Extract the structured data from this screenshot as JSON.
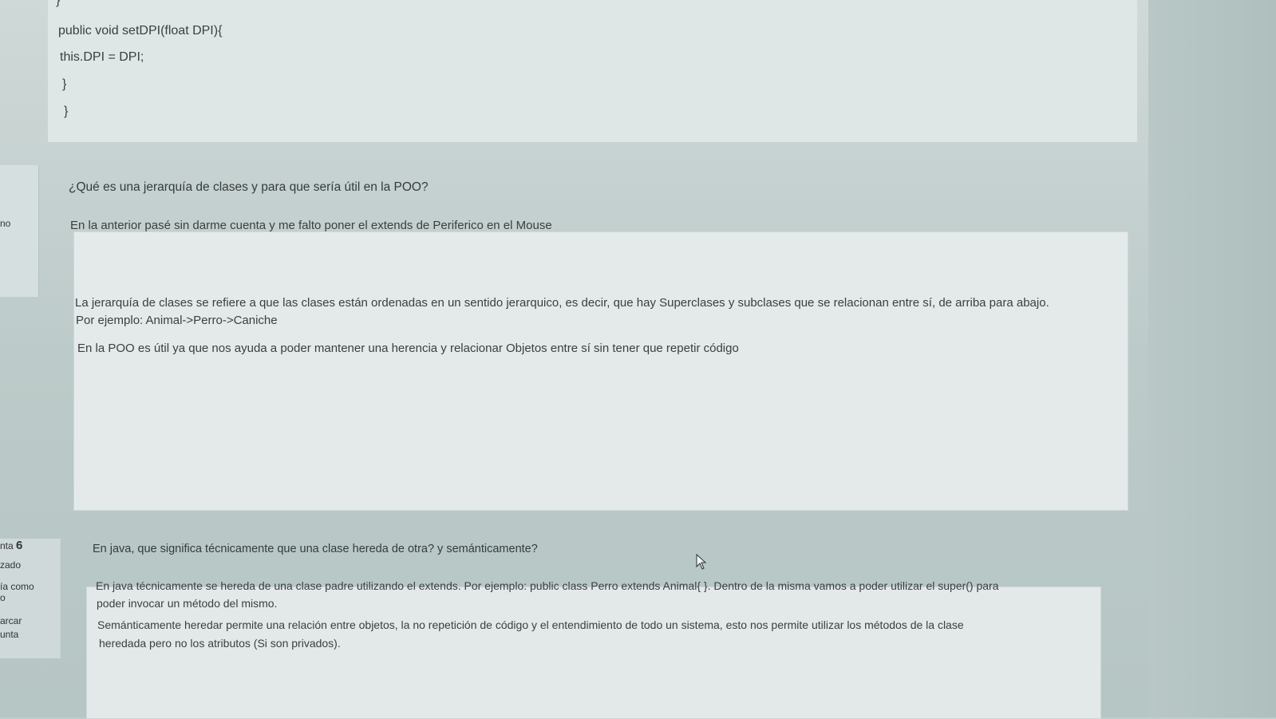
{
  "code": {
    "lines": [
      "}",
      "public void setDPI(float DPI){",
      "this.DPI = DPI;",
      "}",
      "}"
    ]
  },
  "question5": {
    "strip_label": "no",
    "question": "¿Qué es una jerarquía de clases y para que sería útil en la POO?",
    "answer": [
      "En la anterior pasé sin darme cuenta y me falto poner el extends de Periferico en el Mouse",
      "La jerarquía de clases se refiere a que las clases están ordenadas en un sentido jerarquico, es decir, que hay Superclases y subclases que se relacionan entre sí, de arriba para abajo.",
      "Por ejemplo: Animal->Perro->Caniche",
      "En la POO es útil ya que nos ayuda a poder mantener una herencia y relacionar Objetos entre sí sin tener que repetir código"
    ]
  },
  "question6": {
    "strip": {
      "label_prefix": "nta",
      "number": "6",
      "status": "zado",
      "mark_line1": "ía como",
      "mark_line2": "o",
      "flag_line1": "arcar",
      "flag_line2": "unta"
    },
    "question": "En java, que significa técnicamente que una clase hereda de otra? y semánticamente?",
    "answer": [
      "En java técnicamente se hereda de una clase padre utilizando el extends. Por ejemplo: public class Perro extends Animal{ }. Dentro de la misma vamos a poder utilizar el super() para",
      "poder invocar un método del mismo.",
      "Semánticamente heredar permite una relación entre objetos, la no repetición de código y el entendimiento de todo un sistema, esto nos permite utilizar los métodos de la clase",
      "heredada pero no los atributos (Si son privados)."
    ]
  }
}
